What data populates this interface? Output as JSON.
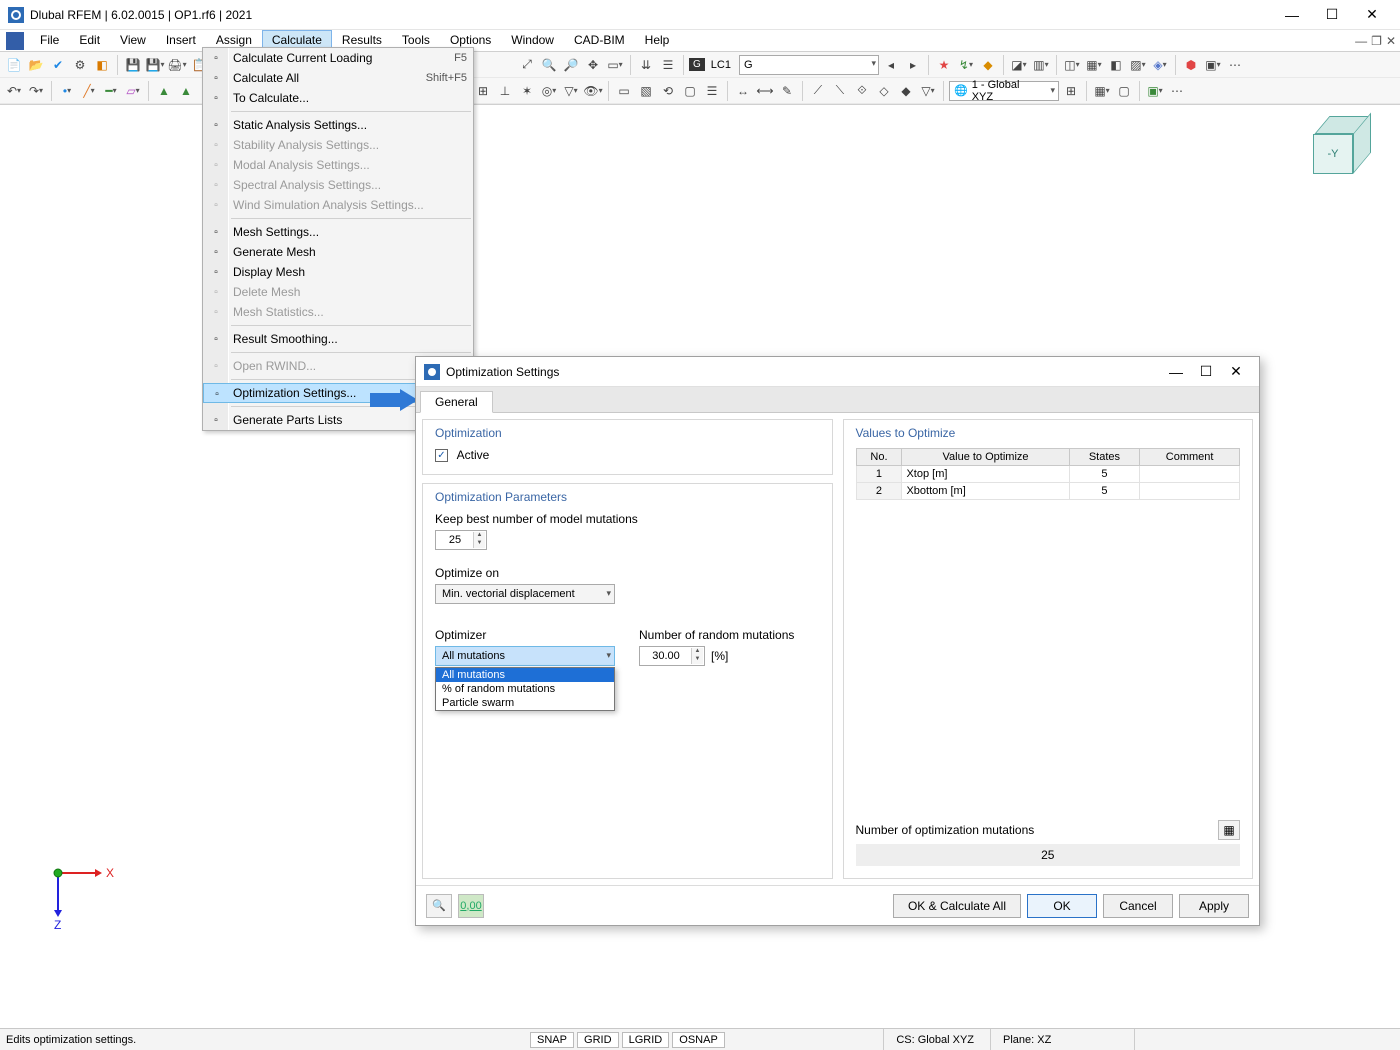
{
  "title": "Dlubal RFEM | 6.02.0015 | OP1.rf6 | 2021",
  "menubar": [
    "File",
    "Edit",
    "View",
    "Insert",
    "Assign",
    "Calculate",
    "Results",
    "Tools",
    "Options",
    "Window",
    "CAD-BIM",
    "Help"
  ],
  "menubar_active_index": 5,
  "toolbar2": {
    "lc_tag": "G",
    "lc_code": "LC1",
    "lc_combo": "G",
    "globe_combo": "1 - Global XYZ"
  },
  "calculate_menu": [
    {
      "label": "Calculate Current Loading",
      "shortcut": "F5"
    },
    {
      "label": "Calculate All",
      "shortcut": "Shift+F5"
    },
    {
      "label": "To Calculate..."
    },
    {
      "sep": true
    },
    {
      "label": "Static Analysis Settings..."
    },
    {
      "label": "Stability Analysis Settings...",
      "disabled": true
    },
    {
      "label": "Modal Analysis Settings...",
      "disabled": true
    },
    {
      "label": "Spectral Analysis Settings...",
      "disabled": true
    },
    {
      "label": "Wind Simulation Analysis Settings...",
      "disabled": true
    },
    {
      "sep": true
    },
    {
      "label": "Mesh Settings..."
    },
    {
      "label": "Generate Mesh"
    },
    {
      "label": "Display Mesh"
    },
    {
      "label": "Delete Mesh",
      "disabled": true
    },
    {
      "label": "Mesh Statistics...",
      "disabled": true
    },
    {
      "sep": true
    },
    {
      "label": "Result Smoothing..."
    },
    {
      "sep": true
    },
    {
      "label": "Open RWIND...",
      "disabled": true
    },
    {
      "sep": true
    },
    {
      "label": "Optimization Settings...",
      "highlight": true
    },
    {
      "sep": true
    },
    {
      "label": "Generate Parts Lists"
    }
  ],
  "dialog": {
    "title": "Optimization Settings",
    "tab": "General",
    "optimization": {
      "section": "Optimization",
      "active_label": "Active",
      "active_checked": true
    },
    "params": {
      "section": "Optimization Parameters",
      "keep_label": "Keep best number of model mutations",
      "keep_value": "25",
      "optimize_on_label": "Optimize on",
      "optimize_on_value": "Min. vectorial displacement",
      "optimizer_label": "Optimizer",
      "optimizer_value": "All mutations",
      "optimizer_options": [
        "All mutations",
        "% of random mutations",
        "Particle swarm"
      ],
      "random_label": "Number of random mutations",
      "random_value": "30.00",
      "random_unit": "[%]"
    },
    "values": {
      "section": "Values to Optimize",
      "headers": [
        "No.",
        "Value to Optimize",
        "States",
        "Comment"
      ],
      "rows": [
        {
          "no": "1",
          "value": "Xtop [m]",
          "states": "5",
          "comment": ""
        },
        {
          "no": "2",
          "value": "Xbottom [m]",
          "states": "5",
          "comment": ""
        }
      ],
      "num_opt_label": "Number of optimization mutations",
      "num_opt_value": "25"
    },
    "buttons": {
      "ok_calc": "OK & Calculate All",
      "ok": "OK",
      "cancel": "Cancel",
      "apply": "Apply"
    }
  },
  "statusbar": {
    "text": "Edits optimization settings.",
    "snap": [
      "SNAP",
      "GRID",
      "LGRID",
      "OSNAP"
    ],
    "cs": "CS: Global XYZ",
    "plane": "Plane: XZ"
  },
  "view_cube_face": "-Y"
}
